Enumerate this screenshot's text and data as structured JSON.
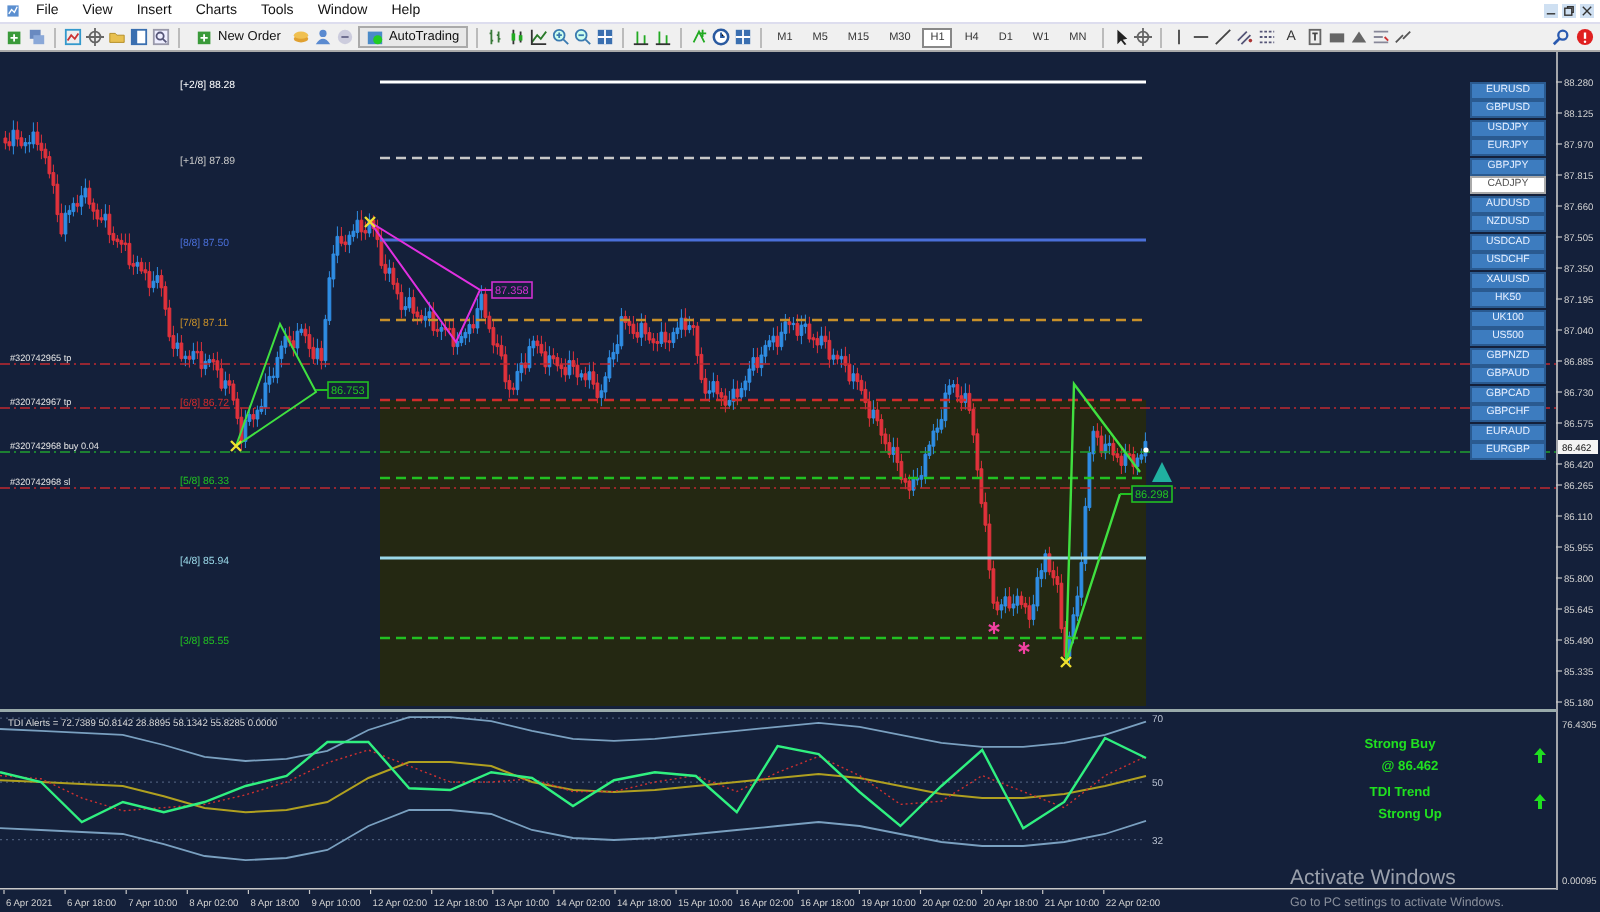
{
  "menu_bar": [
    "File",
    "View",
    "Insert",
    "Charts",
    "Tools",
    "Window",
    "Help"
  ],
  "toolbar": {
    "buttons": [
      {
        "label": "New Order"
      },
      {
        "label": "AutoTrading"
      }
    ],
    "timeframes": [
      {
        "label": "M1",
        "selected": false
      },
      {
        "label": "M5",
        "selected": false
      },
      {
        "label": "M15",
        "selected": false
      },
      {
        "label": "M30",
        "selected": false
      },
      {
        "label": "H1",
        "selected": true
      },
      {
        "label": "H4",
        "selected": false
      },
      {
        "label": "D1",
        "selected": false
      },
      {
        "label": "W1",
        "selected": false
      },
      {
        "label": "MN",
        "selected": false
      }
    ],
    "text_tool": "A"
  },
  "chart": {
    "murrey_levels": [
      {
        "tag": "[+2/8]",
        "value": "88.28",
        "color": "#ffffff"
      },
      {
        "tag": "[+1/8]",
        "value": "87.89",
        "color": "#c8c8c8"
      },
      {
        "tag": "[8/8]",
        "value": "87.50",
        "color": "#4a6fd8"
      },
      {
        "tag": "[7/8]",
        "value": "87.11",
        "color": "#c8902a"
      },
      {
        "tag": "[6/8]",
        "value": "86.72",
        "color": "#d02c2c"
      },
      {
        "tag": "[5/8]",
        "value": "86.33",
        "color": "#22c022"
      },
      {
        "tag": "[4/8]",
        "value": "85.94",
        "color": "#9ad8e8"
      },
      {
        "tag": "[3/8]",
        "value": "85.55",
        "color": "#22c022"
      }
    ],
    "orders": [
      {
        "label": "#320742965 tp",
        "kind": "tp"
      },
      {
        "label": "#320742967 tp",
        "kind": "tp"
      },
      {
        "label": "#320742968 buy 0.04",
        "kind": "entry"
      },
      {
        "label": "#320742968 sl",
        "kind": "sl"
      }
    ],
    "pattern_labels": [
      {
        "text": "86.753",
        "color": "#22c022"
      },
      {
        "text": "87.358",
        "color": "#d030d0"
      },
      {
        "text": "86.298",
        "color": "#22c022"
      }
    ],
    "symbol_buttons": [
      {
        "label": "EURUSD",
        "selected": false
      },
      {
        "label": "GBPUSD",
        "selected": false
      },
      {
        "label": "USDJPY",
        "selected": false
      },
      {
        "label": "EURJPY",
        "selected": false
      },
      {
        "label": "GBPJPY",
        "selected": false
      },
      {
        "label": "CADJPY",
        "selected": true
      },
      {
        "label": "AUDUSD",
        "selected": false
      },
      {
        "label": "NZDUSD",
        "selected": false
      },
      {
        "label": "USDCAD",
        "selected": false
      },
      {
        "label": "USDCHF",
        "selected": false
      },
      {
        "label": "XAUUSD",
        "selected": false
      },
      {
        "label": "HK50",
        "selected": false
      },
      {
        "label": "UK100",
        "selected": false
      },
      {
        "label": "US500",
        "selected": false
      },
      {
        "label": "GBPNZD",
        "selected": false
      },
      {
        "label": "GBPAUD",
        "selected": false
      },
      {
        "label": "GBPCAD",
        "selected": false
      },
      {
        "label": "GBPCHF",
        "selected": false
      },
      {
        "label": "EURAUD",
        "selected": false
      },
      {
        "label": "EURGBP",
        "selected": false
      }
    ],
    "price_axis": [
      "88.280",
      "88.125",
      "87.970",
      "87.815",
      "87.660",
      "87.505",
      "87.350",
      "87.195",
      "87.040",
      "86.885",
      "86.730",
      "86.575",
      "86.420",
      "86.265",
      "86.110",
      "85.955",
      "85.800",
      "85.645",
      "85.490",
      "85.335",
      "85.180"
    ],
    "current_price": "86.462"
  },
  "indicator": {
    "title": "TDI Alerts = 72.7389 50.8142 28.8895 58.1342 55.8285 0.0000",
    "axis": [
      "76.4305",
      "0.00095"
    ],
    "chart_data": {
      "type": "line",
      "ylim": [
        16.9,
        71.9
      ],
      "yticks": [
        {
          "value": 70,
          "label": "70"
        },
        {
          "value": 50,
          "label": "50"
        },
        {
          "value": 32,
          "label": "32"
        }
      ],
      "series": [
        {
          "color": "#30f080",
          "values": [
            53.1,
            50,
            37.5,
            43.8,
            40.6,
            43.8,
            48.8,
            51.9,
            62.5,
            62.5,
            48.1,
            47.5,
            53.1,
            51.3,
            42.5,
            50.6,
            53.1,
            51.9,
            40.6,
            61.3,
            58.8,
            46.9,
            36.3,
            48.8,
            60,
            35.6,
            43.8,
            63.8,
            57.5
          ]
        },
        {
          "color": "#d03030",
          "line_style": "dotted",
          "values": [
            52,
            51,
            45,
            41,
            42,
            43,
            46,
            50,
            56,
            60,
            55,
            50,
            50,
            51,
            47,
            47,
            50,
            52,
            47,
            53,
            58,
            52,
            43,
            44,
            52,
            47,
            42,
            52,
            58
          ]
        },
        {
          "color": "#b0a020",
          "values": [
            50.6,
            50,
            49.4,
            48.8,
            45.6,
            41.9,
            40.6,
            41.3,
            43.8,
            51.3,
            56.3,
            56.3,
            55,
            50,
            47.5,
            46.9,
            47.5,
            48.8,
            50,
            51.3,
            52.5,
            51.3,
            48.8,
            46.3,
            45,
            45,
            46.3,
            48.8,
            51.9
          ]
        },
        {
          "color": "#7aa0c0",
          "values": [
            66.6,
            66,
            65.4,
            64.8,
            61.6,
            57.9,
            56.6,
            57.3,
            59.8,
            66.3,
            70.3,
            70.3,
            69,
            66,
            63.5,
            62.9,
            63.5,
            64.8,
            66,
            67.3,
            68.5,
            67.3,
            64.8,
            62.3,
            61,
            61,
            62.3,
            64.8,
            68.9
          ]
        },
        {
          "color": "#7aa0c0",
          "values": [
            35.6,
            35,
            34.4,
            33.8,
            30.6,
            26.9,
            25.6,
            26.3,
            28.8,
            36.3,
            41.3,
            41.3,
            40,
            35,
            32.5,
            31.9,
            32.5,
            33.8,
            35,
            36.3,
            37.5,
            36.3,
            33.8,
            31.3,
            30,
            30,
            31.3,
            33.8,
            37.9
          ]
        }
      ]
    },
    "signals": [
      "Strong Buy",
      "@ 86.462",
      "TDI Trend",
      "Strong Up"
    ]
  },
  "time_axis": [
    "6 Apr 2021",
    "6 Apr 18:00",
    "7 Apr 10:00",
    "8 Apr 02:00",
    "8 Apr 18:00",
    "9 Apr 10:00",
    "12 Apr 02:00",
    "12 Apr 18:00",
    "13 Apr 10:00",
    "14 Apr 02:00",
    "14 Apr 18:00",
    "15 Apr 10:00",
    "16 Apr 02:00",
    "16 Apr 18:00",
    "19 Apr 10:00",
    "20 Apr 02:00",
    "20 Apr 18:00",
    "21 Apr 10:00",
    "22 Apr 02:00"
  ],
  "os_notice": {
    "title": "Activate Windows",
    "text": "Go to PC settings to activate Windows."
  }
}
